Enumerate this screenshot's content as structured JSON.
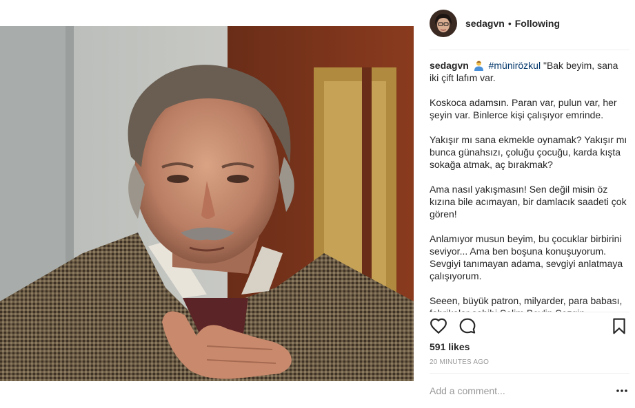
{
  "post": {
    "username": "sedagvn",
    "follow_separator": "•",
    "follow_status": "Following",
    "photo_subject": "film still of an elderly man with grey hair and moustache in a houndstooth coat, hand on chest"
  },
  "caption": {
    "username": "sedagvn",
    "hashtag": "#münirözkul",
    "text": " \"Bak beyim, sana iki çift lafım var.\n\nKoskoca adamsın. Paran var, pulun var, her şeyin var. Binlerce kişi çalışıyor emrinde.\n\nYakışır mı sana ekmekle oynamak? Yakışır mı bunca günahsızı, çoluğu çocuğu, karda kışta sokağa atmak, aç bırakmak?\n\nAma nasıl yakışmasın! Sen değil misin öz kızına bile acımayan, bir damlacık saadeti çok gören!\n\nAnlamıyor musun beyim, bu çocuklar birbirini seviyor... Ama ben boşuna konuşuyorum. Sevgiyi tanımayan adama, sevgiyi anlatmaya çalışıyorum.\n\nSeeen, büyük patron, milyarder, para babası, fabrikalar sahibi Selim Bey'in Sezgin..."
  },
  "actions": {
    "like_icon": "heart-outline-icon",
    "comment_icon": "speech-bubble-icon",
    "save_icon": "bookmark-icon"
  },
  "likes": "591 likes",
  "timestamp": "20 minutes ago",
  "comment": {
    "placeholder": "Add a comment...",
    "value": "",
    "more_icon": "ellipsis-icon"
  },
  "colors": {
    "text": "#262626",
    "hashtag": "#003569",
    "muted": "#999999",
    "divider": "#efefef"
  }
}
